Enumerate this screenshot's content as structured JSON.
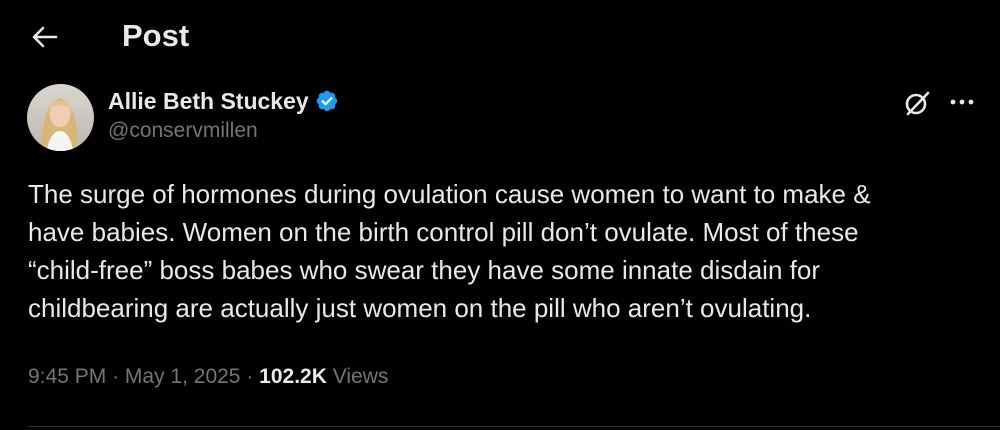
{
  "header": {
    "back_icon": "arrow-left-icon",
    "title": "Post"
  },
  "post": {
    "author": {
      "display_name": "Allie Beth Stuckey",
      "handle": "@conservmillen",
      "verified_icon": "verified-badge-icon",
      "verified_color": "#1d9bf0"
    },
    "actions": {
      "grok_icon": "grok-icon",
      "more_icon": "more-horizontal-icon"
    },
    "text": "The surge of hormones during ovulation cause women to want to make &\nhave babies. Women on the birth control pill don’t ovulate. Most of these\n“child-free” boss babes who swear they have some innate disdain for\nchildbearing are actually just women on the pill who aren’t ovulating.",
    "time": "9:45 PM",
    "date": "May 1, 2025",
    "separator": "·",
    "views_count": "102.2K",
    "views_label": "Views"
  },
  "colors": {
    "background": "#000000",
    "primary_text": "#e7e9ea",
    "secondary_text": "#71767b",
    "divider": "#2f3336"
  }
}
